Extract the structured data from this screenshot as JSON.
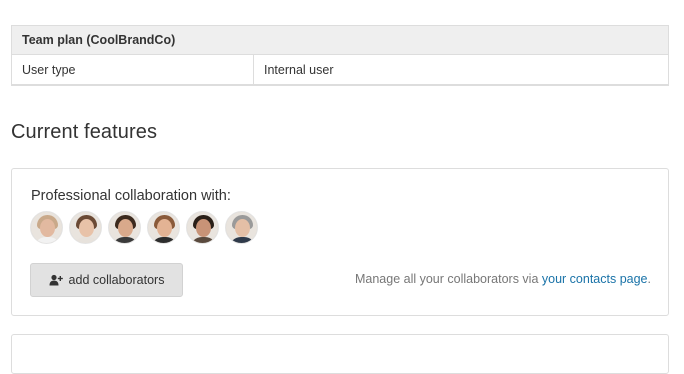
{
  "plan": {
    "header": "Team plan (CoolBrandCo)",
    "rows": [
      {
        "key": "User type",
        "value": "Internal user"
      }
    ]
  },
  "features": {
    "section_title": "Current features",
    "collab_title": "Professional collaboration with:",
    "avatars": [
      {
        "name": "collaborator-1",
        "hair": "#c9a98a",
        "face": "#e2b9a0",
        "body": "#f2f2f2"
      },
      {
        "name": "collaborator-2",
        "hair": "#6b4a35",
        "face": "#e8c2a8",
        "body": "#e7e2dc"
      },
      {
        "name": "collaborator-3",
        "hair": "#3c2a1e",
        "face": "#d9a98b",
        "body": "#3a3a3a"
      },
      {
        "name": "collaborator-4",
        "hair": "#8a5a3a",
        "face": "#e3b394",
        "body": "#2d2d2d"
      },
      {
        "name": "collaborator-5",
        "hair": "#2a1f18",
        "face": "#c89377",
        "body": "#5a4a3e"
      },
      {
        "name": "collaborator-6",
        "hair": "#9a9a9a",
        "face": "#e4bfa6",
        "body": "#2f3a4a"
      }
    ],
    "add_button_label": "add collaborators",
    "manage_prefix": "Manage all your collaborators via ",
    "manage_link": "your contacts page",
    "manage_suffix": "."
  },
  "colors": {
    "link": "#1a73a8",
    "button_bg": "#e2e2e2",
    "header_bg": "#efefef"
  },
  "icons": {
    "add_button": "add-user-icon"
  }
}
